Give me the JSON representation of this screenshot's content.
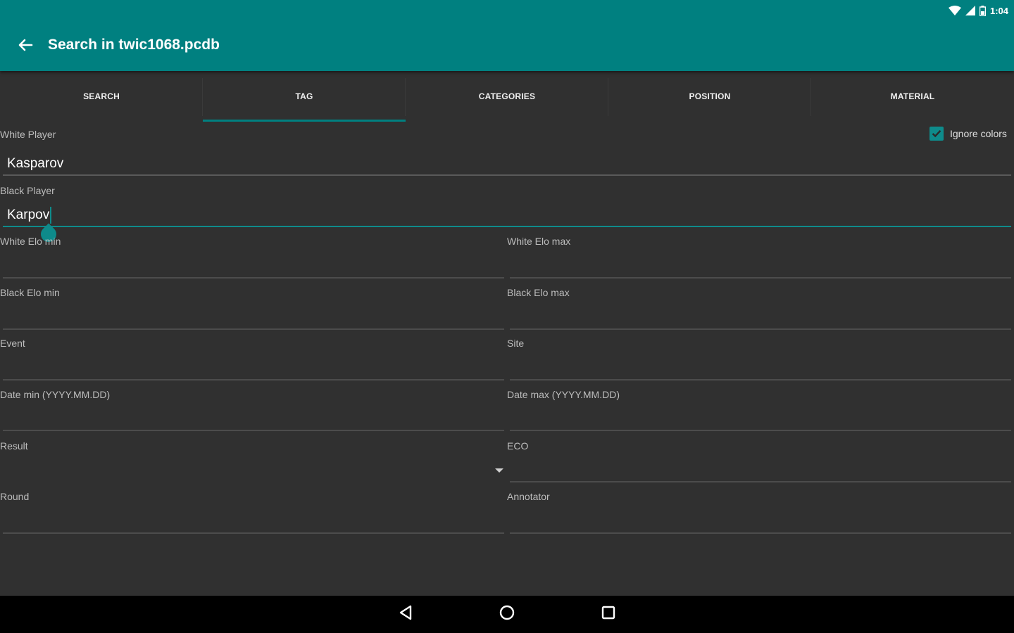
{
  "status_bar": {
    "time": "1:04"
  },
  "app_bar": {
    "title": "Search in twic1068.pcdb",
    "background": "#008080"
  },
  "tabs": [
    {
      "label": "SEARCH"
    },
    {
      "label": "TAG",
      "active": true
    },
    {
      "label": "CATEGORIES"
    },
    {
      "label": "POSITION"
    },
    {
      "label": "MATERIAL"
    }
  ],
  "form": {
    "white_player": {
      "label": "White Player",
      "value": "Kasparov"
    },
    "ignore_colors": {
      "label": "Ignore colors",
      "checked": true
    },
    "black_player": {
      "label": "Black Player",
      "value": "Karpov"
    },
    "white_elo_min": {
      "label": "White Elo min",
      "value": ""
    },
    "white_elo_max": {
      "label": "White Elo max",
      "value": ""
    },
    "black_elo_min": {
      "label": "Black Elo min",
      "value": ""
    },
    "black_elo_max": {
      "label": "Black Elo max",
      "value": ""
    },
    "event": {
      "label": "Event",
      "value": ""
    },
    "site": {
      "label": "Site",
      "value": ""
    },
    "date_min": {
      "label": "Date min (YYYY.MM.DD)",
      "value": ""
    },
    "date_max": {
      "label": "Date max (YYYY.MM.DD)",
      "value": ""
    },
    "result": {
      "label": "Result",
      "value": ""
    },
    "eco": {
      "label": "ECO",
      "value": ""
    },
    "round": {
      "label": "Round",
      "value": ""
    },
    "annotator": {
      "label": "Annotator",
      "value": ""
    }
  },
  "colors": {
    "accent": "#008080",
    "background": "#303030"
  }
}
